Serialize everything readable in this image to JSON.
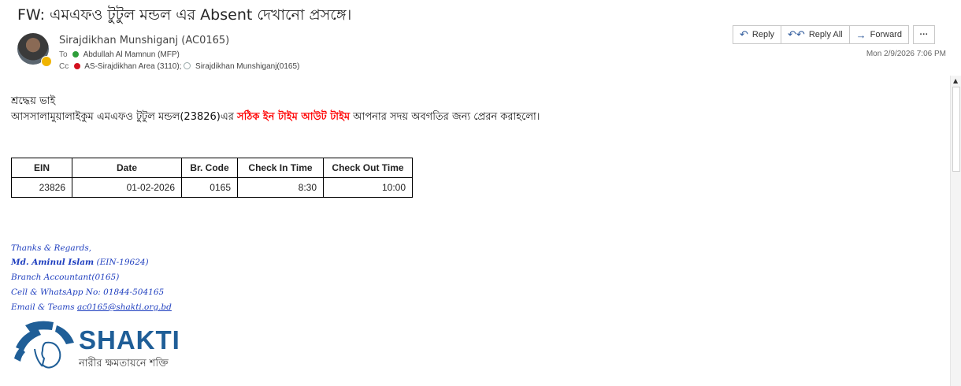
{
  "email": {
    "subject": "FW: এমএফও টুটুল মন্ডল এর Absent দেখানো প্রসঙ্গে।",
    "sender": "Sirajdikhan Munshiganj (AC0165)",
    "to_label": "To",
    "to_value": "Abdullah Al Mamnun (MFP)",
    "cc_label": "Cc",
    "cc_value1": "AS-Sirajdikhan Area (3110);",
    "cc_value2": "Sirajdikhan Munshiganj(0165)",
    "date": "Mon 2/9/2026 7:06 PM"
  },
  "actions": {
    "reply": "Reply",
    "reply_all": "Reply All",
    "forward": "Forward",
    "more": "···"
  },
  "body": {
    "greeting": "শ্রদ্ধেয় ভাই",
    "line_prefix": "আসসালামুয়ালাইকুম এমএফও টুটুল মন্ডল(23826)এর ",
    "highlight": "সঠিক ইন টাইম  আউট টাইম",
    "line_suffix": " আপনার সদয় অবগতির জন্য প্রেরন করাহলো।",
    "highlight_color": "#ff0000"
  },
  "table": {
    "headers": [
      "EIN",
      "Date",
      "Br. Code",
      "Check In Time",
      "Check Out Time"
    ],
    "rows": [
      [
        "23826",
        "01-02-2026",
        "0165",
        "8:30",
        "10:00"
      ]
    ]
  },
  "signature": {
    "thanks": "Thanks & Regards,",
    "name": "Md. Aminul Islam",
    "ein": " (EIN-19624)",
    "role": "Branch Accountant(0165)",
    "phone": "Cell & WhatsApp No: 01844-504165",
    "email_label": "Email & Teams ",
    "email": "ac0165@shakti.org.bd",
    "color": "#1f3fbf"
  },
  "logo": {
    "brand": "SHAKTI",
    "tagline": "নারীর ক্ষমতায়নে শক্তি",
    "color": "#1f5e97"
  }
}
